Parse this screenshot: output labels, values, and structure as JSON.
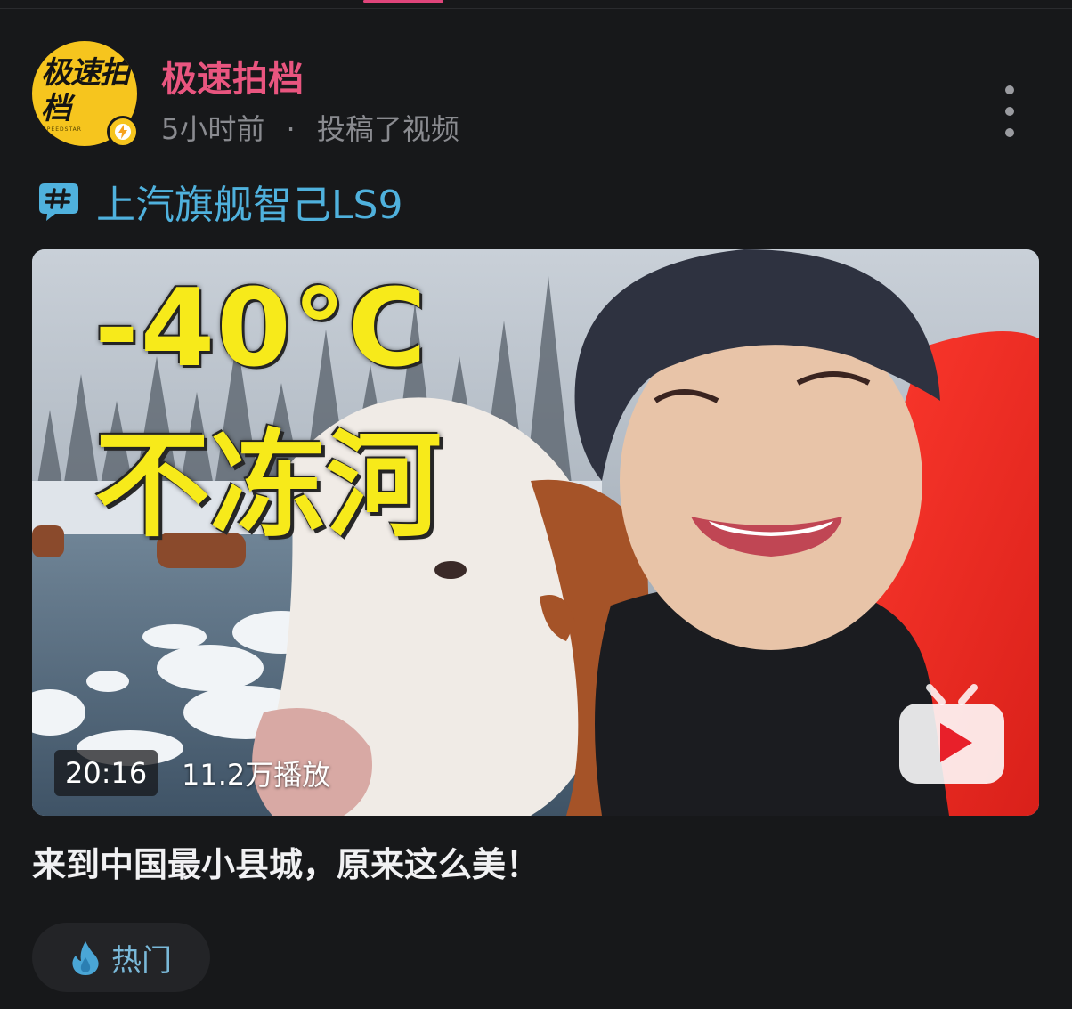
{
  "author": {
    "name": "极速拍档",
    "avatar_text": "极速拍档",
    "avatar_subtext": "SPEEDSTAR",
    "time": "5小时前",
    "separator": "·",
    "action": "投稿了视频"
  },
  "topic": {
    "label": "上汽旗舰智己LS9",
    "icon": "hashtag-bubble-icon"
  },
  "video": {
    "overlay_line1": "-40°C",
    "overlay_line2": "不冻河",
    "duration": "20:16",
    "play_count": "11.2万播放",
    "title": "来到中国最小县城，原来这么美！"
  },
  "tag": {
    "label": "热门",
    "icon": "flame-icon"
  },
  "colors": {
    "background": "#17181a",
    "author_name": "#e9557f",
    "topic": "#4fb1dd",
    "avatar_bg": "#f6c51e",
    "overlay_text": "#f7ea1a",
    "tag_text": "#7ab9d9"
  }
}
